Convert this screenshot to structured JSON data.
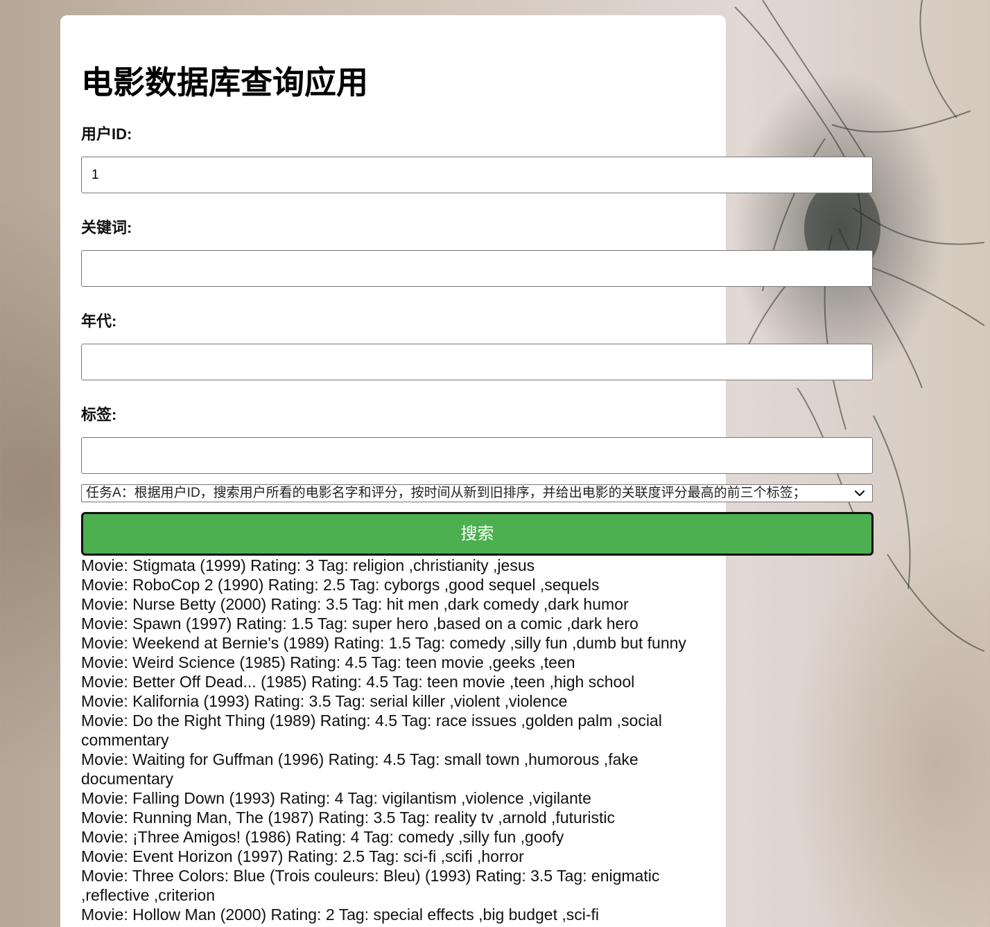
{
  "app": {
    "title": "电影数据库查询应用"
  },
  "form": {
    "user_id": {
      "label": "用户ID:",
      "value": "1"
    },
    "keyword": {
      "label": "关键词:",
      "value": ""
    },
    "era": {
      "label": "年代:",
      "value": ""
    },
    "tag": {
      "label": "标签:",
      "value": ""
    },
    "task_select": {
      "selected": "任务A：根据用户ID，搜索用户所看的电影名字和评分，按时间从新到旧排序，并给出电影的关联度评分最高的前三个标签；"
    },
    "search_button": "搜索"
  },
  "results": [
    "Movie: Stigmata (1999) Rating: 3 Tag: religion ,christianity ,jesus",
    "Movie: RoboCop 2 (1990) Rating: 2.5 Tag: cyborgs ,good sequel ,sequels",
    "Movie: Nurse Betty (2000) Rating: 3.5 Tag: hit men ,dark comedy ,dark humor",
    "Movie: Spawn (1997) Rating: 1.5 Tag: super hero ,based on a comic ,dark hero",
    "Movie: Weekend at Bernie's (1989) Rating: 1.5 Tag: comedy ,silly fun ,dumb but funny",
    "Movie: Weird Science (1985) Rating: 4.5 Tag: teen movie ,geeks ,teen",
    "Movie: Better Off Dead... (1985) Rating: 4.5 Tag: teen movie ,teen ,high school",
    "Movie: Kalifornia (1993) Rating: 3.5 Tag: serial killer ,violent ,violence",
    "Movie: Do the Right Thing (1989) Rating: 4.5 Tag: race issues ,golden palm ,social commentary",
    "Movie: Waiting for Guffman (1996) Rating: 4.5 Tag: small town ,humorous ,fake documentary",
    "Movie: Falling Down (1993) Rating: 4 Tag: vigilantism ,violence ,vigilante",
    "Movie: Running Man, The (1987) Rating: 3.5 Tag: reality tv ,arnold ,futuristic",
    "Movie: ¡Three Amigos! (1986) Rating: 4 Tag: comedy ,silly fun ,goofy",
    "Movie: Event Horizon (1997) Rating: 2.5 Tag: sci-fi ,scifi ,horror",
    "Movie: Three Colors: Blue (Trois couleurs: Bleu) (1993) Rating: 3.5 Tag: enigmatic ,reflective ,criterion",
    "Movie: Hollow Man (2000) Rating: 2 Tag: special effects ,big budget ,sci-fi"
  ],
  "colors": {
    "button_bg": "#4caf50",
    "button_text": "#ffffff",
    "card_bg": "#ffffff"
  }
}
